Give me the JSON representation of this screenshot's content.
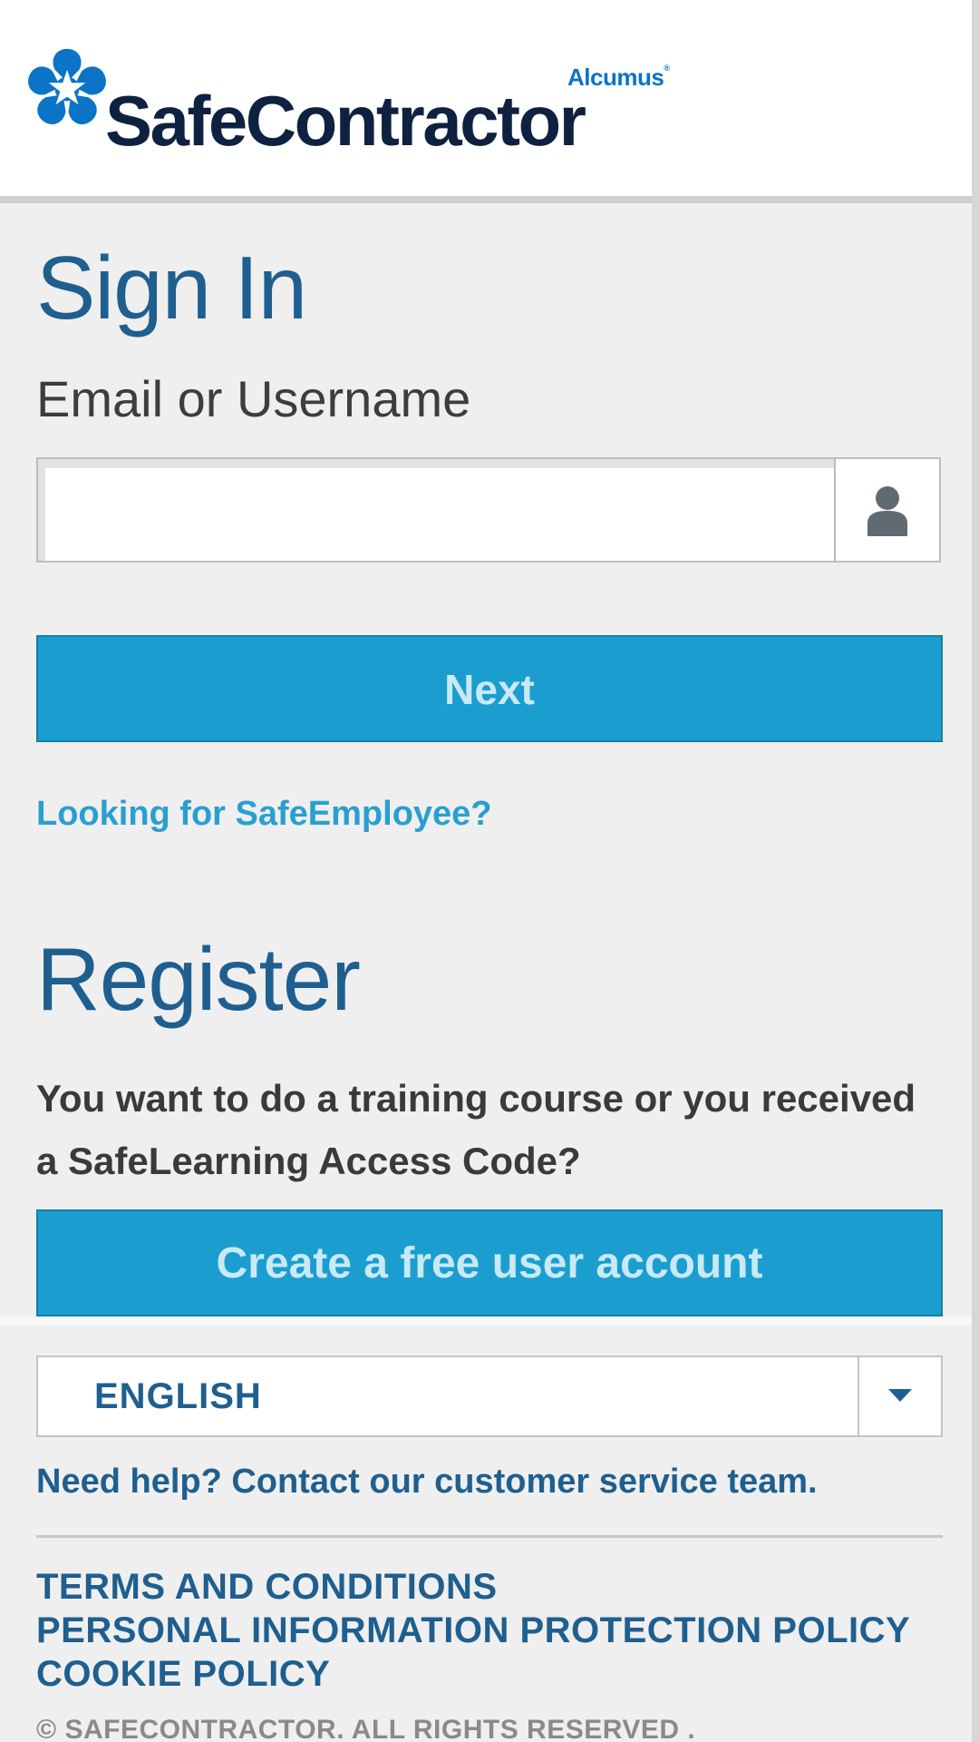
{
  "brand": {
    "parent": "Alcumus",
    "name": "SafeContractor",
    "mark_icon": "star-flower-logo-icon",
    "colors": {
      "mark": "#0b74c6",
      "name": "#0e2140",
      "parent": "#0b74c6"
    }
  },
  "signin": {
    "title": "Sign In",
    "field_label": "Email or Username",
    "username_value": "",
    "username_icon": "user-icon",
    "next_label": "Next",
    "alt_link": "Looking for SafeEmployee?"
  },
  "register": {
    "title": "Register",
    "prompt": "You want to do a training course or you received a SafeLearning Access Code?",
    "create_label": "Create a free user account"
  },
  "footer": {
    "language": "ENGLISH",
    "language_icon": "caret-down-icon",
    "help_link": "Need help? Contact our customer service team.",
    "legal": [
      "TERMS AND CONDITIONS",
      "PERSONAL INFORMATION PROTECTION POLICY",
      "COOKIE POLICY"
    ],
    "copyright": "© SAFECONTRACTOR. ALL RIGHTS RESERVED ."
  },
  "colors": {
    "primary_button": "#1b9ecf",
    "heading": "#1f5f8f",
    "link": "#2a9fcf",
    "background": "#efefef"
  }
}
